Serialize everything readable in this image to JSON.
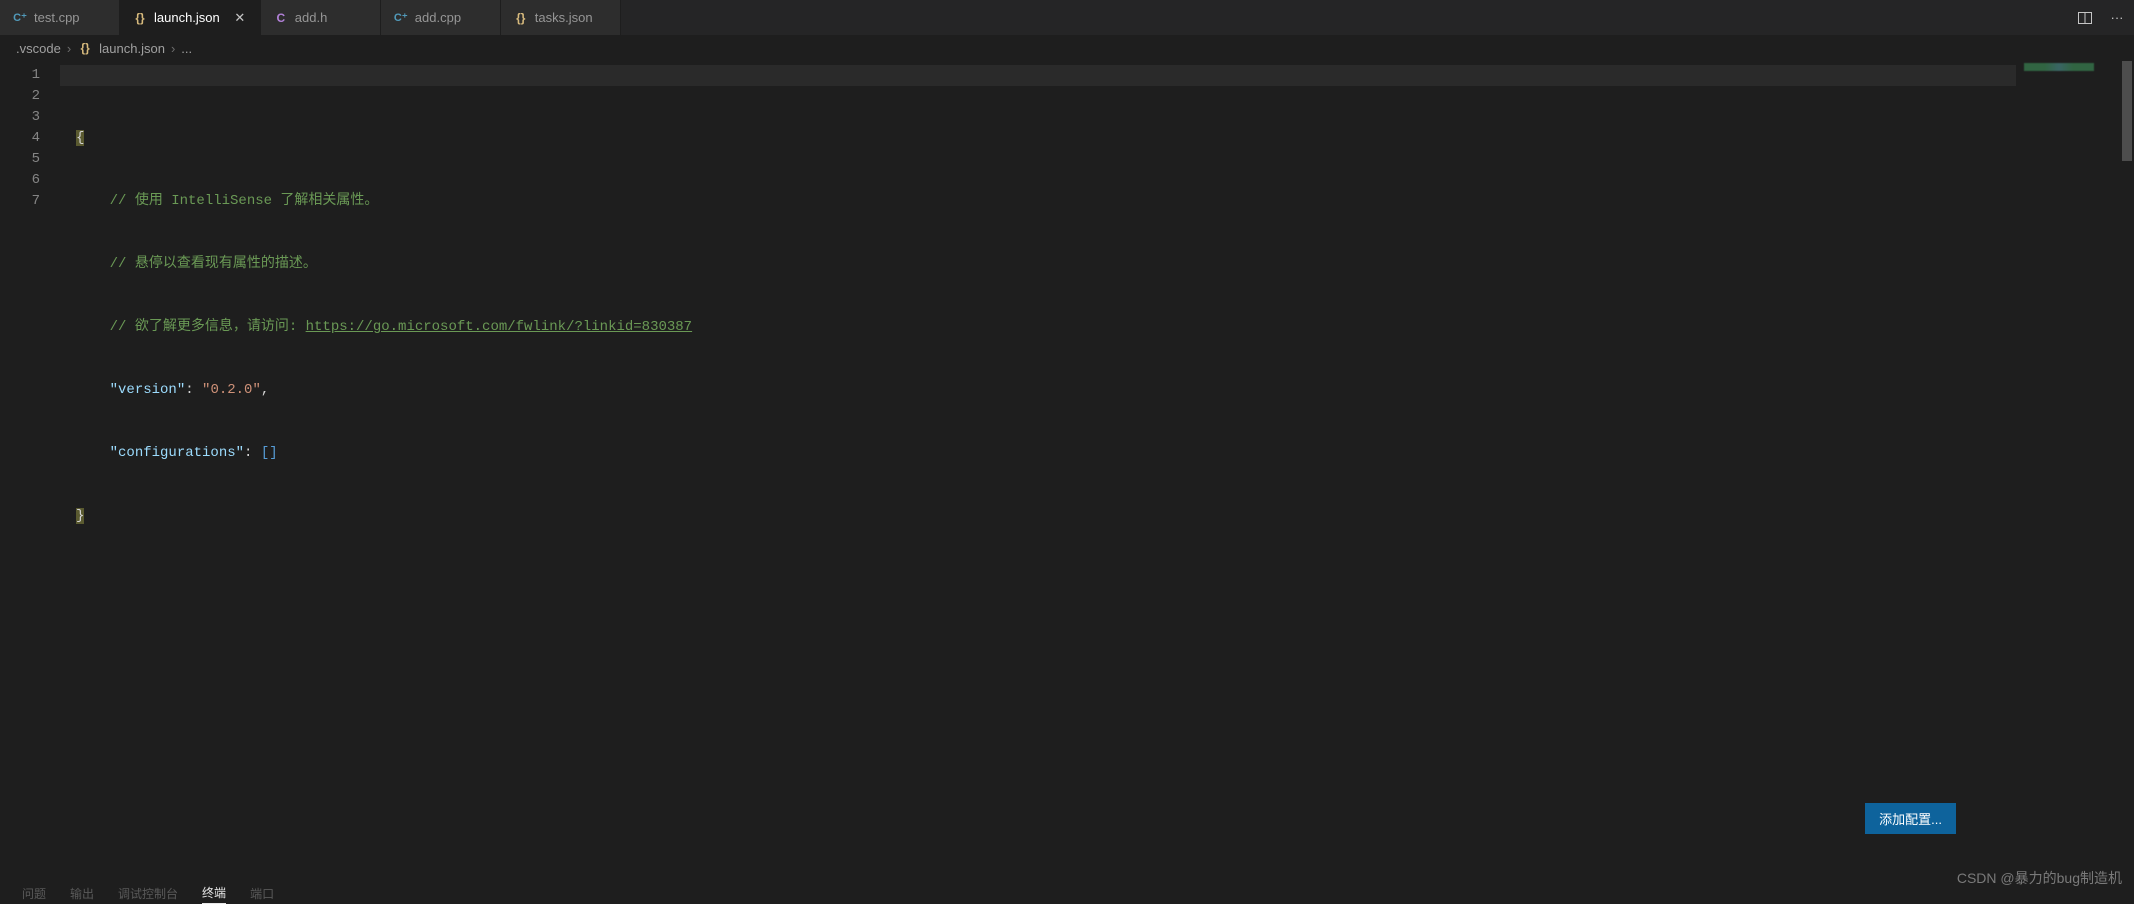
{
  "tabs": [
    {
      "icon": "cpp",
      "label": "test.cpp",
      "active": false,
      "close": false
    },
    {
      "icon": "json",
      "label": "launch.json",
      "active": true,
      "close": true
    },
    {
      "icon": "c",
      "label": "add.h",
      "active": false,
      "close": false
    },
    {
      "icon": "cpp",
      "label": "add.cpp",
      "active": false,
      "close": false
    },
    {
      "icon": "json",
      "label": "tasks.json",
      "active": false,
      "close": false
    }
  ],
  "breadcrumbs": {
    "seg0": ".vscode",
    "seg1": "launch.json",
    "seg2": "..."
  },
  "icons": {
    "cpp": "C⁺",
    "c": "C",
    "json": "{}",
    "close": "✕",
    "chevron": "›",
    "split": "▯▯",
    "more": "···"
  },
  "code": {
    "line1_open": "{",
    "line2_pre": "// 使用 IntelliSense 了解相关属性。",
    "line3": "// 悬停以查看现有属性的描述。",
    "line4_pre": "// 欲了解更多信息，请访问: ",
    "line4_link": "https://go.microsoft.com/fwlink/?linkid=830387",
    "line5_key": "\"version\"",
    "line5_val": "\"0.2.0\"",
    "line6_key": "\"configurations\"",
    "line6_val": "[]",
    "line7_close": "}"
  },
  "line_numbers": [
    "1",
    "2",
    "3",
    "4",
    "5",
    "6",
    "7"
  ],
  "add_config_label": "添加配置...",
  "panel": {
    "tab0": "问题",
    "tab1": "输出",
    "tab2": "调试控制台",
    "tab3": "终端",
    "tab4": "端口"
  },
  "watermark": "CSDN @暴力的bug制造机"
}
